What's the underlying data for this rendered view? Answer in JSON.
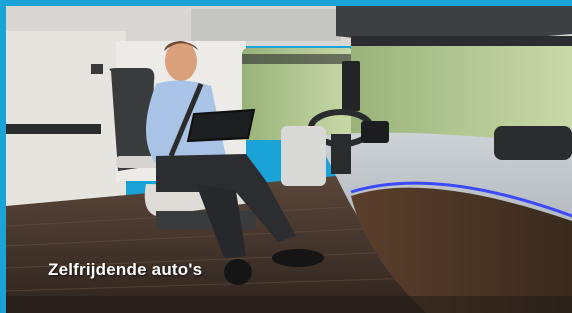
{
  "caption": {
    "text": "Zelfrijdende auto's"
  },
  "colors": {
    "frame": "#1aa3d6",
    "caption": "#ffffff",
    "ambient_light": "#3b49ff"
  },
  "scene": {
    "description_icons": [
      "seated-man",
      "tablet",
      "steering-wheel",
      "truck-cab-window",
      "wood-floor"
    ]
  }
}
